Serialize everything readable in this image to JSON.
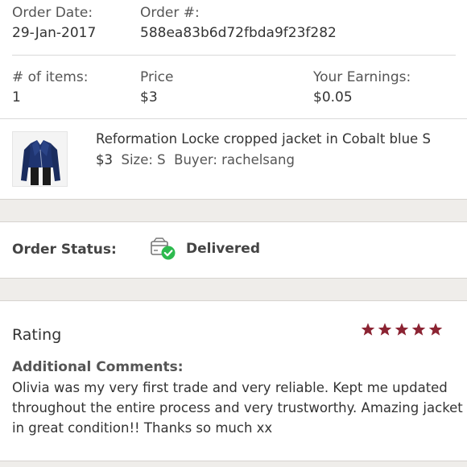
{
  "order": {
    "date_label": "Order Date:",
    "date_value": "29-Jan-2017",
    "number_label": "Order #:",
    "number_value": "588ea83b6d72fbda9f23f282",
    "items_label": "# of items:",
    "items_value": "1",
    "price_label": "Price",
    "price_value": "$3",
    "earnings_label": "Your Earnings:",
    "earnings_value": "$0.05"
  },
  "product": {
    "title": "Reformation Locke cropped jacket in Cobalt blue S",
    "price": "$3",
    "size": "Size: S",
    "buyer": "Buyer: rachelsang",
    "thumbnail_icon": "jacket-thumbnail"
  },
  "status": {
    "label": "Order Status:",
    "value": "Delivered",
    "icon": "delivered-box-check-icon",
    "icon_color": "#2dba4e"
  },
  "rating": {
    "title": "Rating",
    "stars": 5,
    "star_color": "#8b2332",
    "comments_label": "Additional Comments:",
    "comment": "Olivia was my very first trade and very reliable. Kept me updated throughout the entire process and very trustworthy. Amazing jacket in great condition!! Thanks so much xx"
  }
}
